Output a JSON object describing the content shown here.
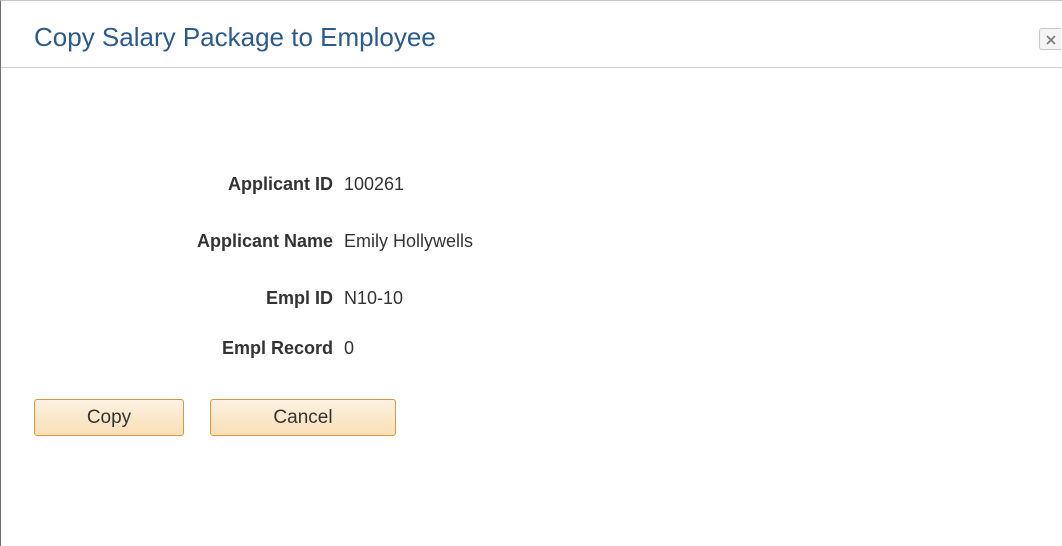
{
  "dialog": {
    "title": "Copy Salary Package to Employee",
    "close_icon": "close-icon"
  },
  "fields": {
    "applicant_id": {
      "label": "Applicant ID",
      "value": "100261"
    },
    "applicant_name": {
      "label": "Applicant Name",
      "value": "Emily Hollywells"
    },
    "empl_id": {
      "label": "Empl ID",
      "value": "N10-10"
    },
    "empl_record": {
      "label": "Empl Record",
      "value": "0"
    }
  },
  "buttons": {
    "copy_label": "Copy",
    "cancel_label": "Cancel"
  },
  "colors": {
    "title": "#2c5a8c",
    "button_border": "#d29a44",
    "button_fill": "#f9dfb6"
  }
}
